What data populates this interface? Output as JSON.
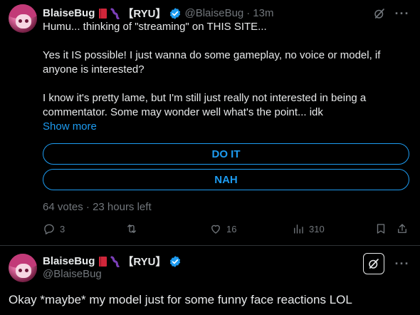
{
  "post1": {
    "author": {
      "name": "BlaiseBug",
      "tag": "【RYU】",
      "handle": "@BlaiseBug",
      "separator": "·",
      "time": "13m"
    },
    "body": [
      "Humu... thinking of \"streaming\" on THIS SITE...",
      "Yes it IS possible! I just wanna do some gameplay, no voice or model, if anyone is interested?",
      "I know it's pretty lame, but I'm still just really not interested in being a commentator. Some may wonder well what's the point... idk"
    ],
    "show_more": "Show more",
    "poll": {
      "options": [
        "DO IT",
        "NAH"
      ],
      "votes": "64 votes",
      "separator": "·",
      "time_left": "23 hours left"
    },
    "actions": {
      "replies": "3",
      "retweets": "",
      "likes": "16",
      "views": "310"
    }
  },
  "post2": {
    "author": {
      "name": "BlaiseBug",
      "tag": "【RYU】",
      "handle": "@BlaiseBug"
    },
    "body": "Okay *maybe* my model just for some funny face reactions LOL"
  },
  "colors": {
    "accent": "#1d9bf0",
    "muted": "#71767b",
    "background": "#000000",
    "text": "#e7e9ea",
    "book": "#d0263a",
    "worm": "#7b3fb8"
  },
  "icons": [
    "grok-icon",
    "more-icon",
    "reply-icon",
    "retweet-icon",
    "like-icon",
    "views-icon",
    "bookmark-icon",
    "share-icon",
    "verified-icon",
    "book-emoji",
    "worm-emoji"
  ]
}
